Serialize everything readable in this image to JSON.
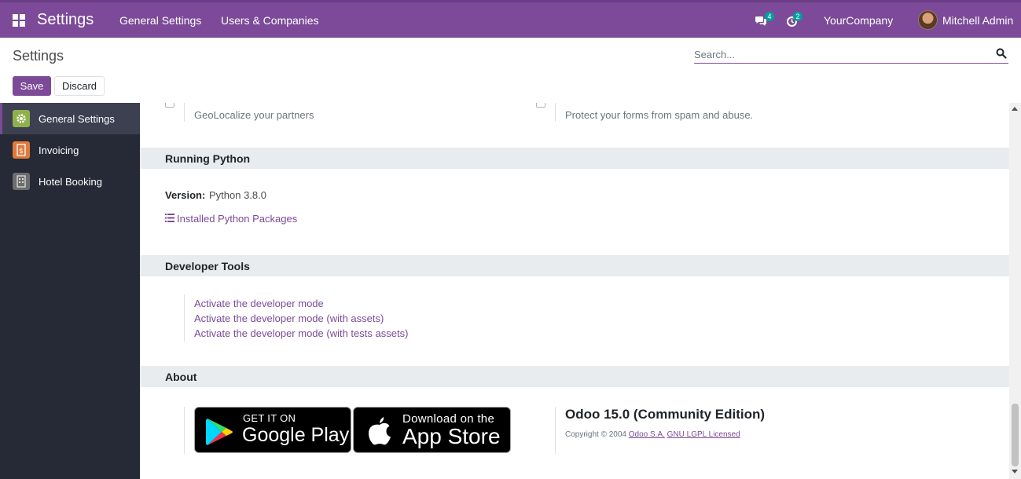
{
  "navbar": {
    "app_title": "Settings",
    "menu": [
      "General Settings",
      "Users & Companies"
    ],
    "messages_count": "4",
    "activities_count": "2",
    "company": "YourCompany",
    "user": "Mitchell Admin"
  },
  "control_panel": {
    "breadcrumb": "Settings",
    "search_placeholder": "Search...",
    "save_label": "Save",
    "discard_label": "Discard"
  },
  "sidebar": {
    "items": [
      {
        "label": "General Settings",
        "icon": "gear-icon",
        "color": "#8fb14b",
        "active": true
      },
      {
        "label": "Invoicing",
        "icon": "invoice-icon",
        "color": "#e07a3b"
      },
      {
        "label": "Hotel Booking",
        "icon": "hotel-icon",
        "color": "#6d6d6d"
      }
    ]
  },
  "content": {
    "geo_text": "GeoLocalize your partners",
    "spam_text": "Protect your forms from spam and abuse.",
    "running_python": {
      "title": "Running Python",
      "version_label": "Version:",
      "version_value": "Python 3.8.0",
      "packages_link": "Installed Python Packages"
    },
    "developer_tools": {
      "title": "Developer Tools",
      "links": [
        "Activate the developer mode",
        "Activate the developer mode (with assets)",
        "Activate the developer mode (with tests assets)"
      ]
    },
    "about": {
      "title": "About",
      "google_play_small": "GET IT ON",
      "google_play_big": "Google Play",
      "app_store_small": "Download on the",
      "app_store_big": "App Store",
      "edition": "Odoo 15.0 (Community Edition)",
      "copyright": "Copyright © 2004",
      "company_link": "Odoo S.A.",
      "license_link": "GNU LGPL Licensed"
    }
  },
  "colors": {
    "brand": "#7c4a98",
    "sidebar_bg": "#262a36",
    "badge": "#00a09d"
  }
}
